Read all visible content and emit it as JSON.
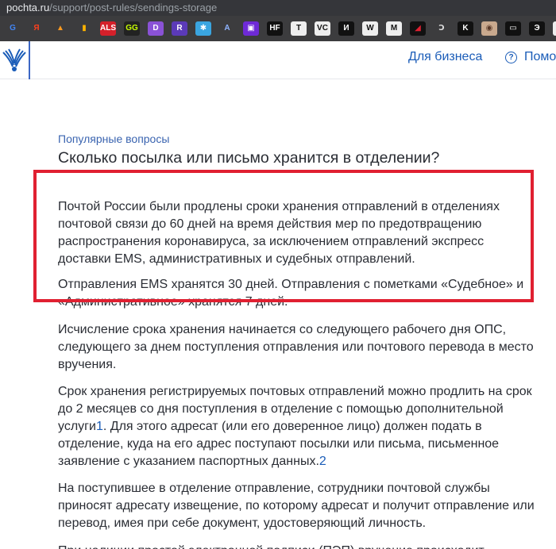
{
  "browser": {
    "url_host": "pochta.ru",
    "url_path": "/support/post-rules/sendings-storage",
    "bookmarks": [
      {
        "icon": "google-icon",
        "label": "G",
        "bg": "#3c3c3e",
        "fg": "#4285f4"
      },
      {
        "icon": "yandex-icon",
        "label": "Я",
        "bg": "#3c3c3e",
        "fg": "#fc3f1d"
      },
      {
        "icon": "bookmark-icon",
        "label": "▲",
        "bg": "#3c3c3e",
        "fg": "#ff9a1f"
      },
      {
        "icon": "stats-icon",
        "label": "▮",
        "bg": "#3c3c3e",
        "fg": "#ffb400"
      },
      {
        "icon": "bookmark-icon",
        "label": "ALS",
        "bg": "#d4202a",
        "fg": "#ffffff"
      },
      {
        "icon": "bookmark-icon",
        "label": "GG",
        "bg": "#222222",
        "fg": "#c8ff00"
      },
      {
        "icon": "bookmark-icon",
        "label": "D",
        "bg": "#8a52d6",
        "fg": "#ffffff"
      },
      {
        "icon": "bookmark-icon",
        "label": "R",
        "bg": "#5b3ab8",
        "fg": "#ffffff"
      },
      {
        "icon": "bookmark-icon",
        "label": "✱",
        "bg": "#3aa5e0",
        "fg": "#ffffff"
      },
      {
        "icon": "bookmark-icon",
        "label": "A",
        "bg": "#3c3c3e",
        "fg": "#8fb4ff"
      },
      {
        "icon": "bookmark-icon",
        "label": "▣",
        "bg": "#6e2ad6",
        "fg": "#ffffff"
      },
      {
        "icon": "bookmark-icon",
        "label": "HF",
        "bg": "#111111",
        "fg": "#ffffff"
      },
      {
        "icon": "bookmark-icon",
        "label": "T",
        "bg": "#eeeeee",
        "fg": "#111111"
      },
      {
        "icon": "bookmark-icon",
        "label": "VC",
        "bg": "#eeeeee",
        "fg": "#111111"
      },
      {
        "icon": "bookmark-icon",
        "label": "И",
        "bg": "#111111",
        "fg": "#ffffff"
      },
      {
        "icon": "bookmark-icon",
        "label": "W",
        "bg": "#eeeeee",
        "fg": "#111111"
      },
      {
        "icon": "bookmark-icon",
        "label": "M",
        "bg": "#eeeeee",
        "fg": "#111111"
      },
      {
        "icon": "bookmark-icon",
        "label": "◢",
        "bg": "#111111",
        "fg": "#e02031"
      },
      {
        "icon": "bookmark-icon",
        "label": "Ↄ",
        "bg": "#3c3c3e",
        "fg": "#dddddd"
      },
      {
        "icon": "bookmark-icon",
        "label": "K",
        "bg": "#111111",
        "fg": "#ffffff"
      },
      {
        "icon": "bookmark-icon",
        "label": "◉",
        "bg": "#c9a98e",
        "fg": "#5a3a2a"
      },
      {
        "icon": "bookmark-icon",
        "label": "▭",
        "bg": "#111111",
        "fg": "#ffffff"
      },
      {
        "icon": "bookmark-icon",
        "label": "Э",
        "bg": "#111111",
        "fg": "#ffffff"
      },
      {
        "icon": "bookmark-icon",
        "label": "▥",
        "bg": "#eeeeee",
        "fg": "#111111"
      }
    ]
  },
  "header": {
    "business_link": "Для бизнеса",
    "help_link": "Помощь",
    "help_icon_glyph": "?"
  },
  "article": {
    "breadcrumb": "Популярные вопросы",
    "title": "Сколько посылка или письмо хранится в отделении?",
    "highlight_color": "#e02031",
    "p1": "Почтой России были продлены сроки хранения отправлений в отделениях почтовой связи до 60 дней на время действия мер по предотвращению распространения коронавируса, за исключением отправлений экспресс доставки EMS, административных и судебных отправлений.",
    "p2": "Отправления EMS хранятся 30 дней. Отправления с пометками «Судебное» и «Административное» хранятся 7 дней.",
    "p3": "Исчисление срока хранения начинается со следующего рабочего дня ОПС, следующего за днем поступления отправления или почтового перевода в место вручения.",
    "p4_a": "Срок хранения регистрируемых почтовых отправлений можно продлить на срок до 2 месяцев со дня поступления в отделение с помощью дополнительной услуги",
    "p4_fn1": "1",
    "p4_b": ". Для этого адресат (или его доверенное лицо) должен подать в отделение, куда на его адрес поступают посылки или письма, письменное заявление с указанием паспортных данных.",
    "p4_fn2": "2",
    "p5": "На поступившее в отделение отправление, сотрудники почтовой службы приносят адресату извещение, по которому адресат и получит отправление или перевод, имея при себе документ, удостоверяющий личность.",
    "p6": "При наличии простой электронной подписи (ПЭП) вручение происходит"
  }
}
